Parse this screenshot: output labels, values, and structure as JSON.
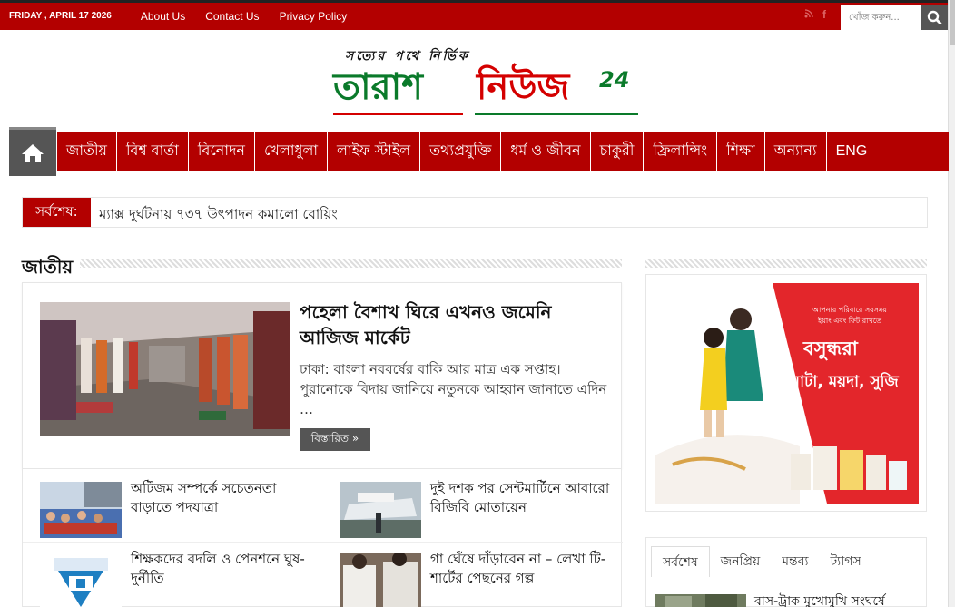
{
  "topbar": {
    "date": "FRIDAY , APRIL 17 2026",
    "links": [
      "About Us",
      "Contact Us",
      "Privacy Policy"
    ],
    "search_placeholder": "খোঁজ করুন..."
  },
  "logo": {
    "tagline": "সত্যের পথে নির্ভিক",
    "word1": "তারাশ",
    "word2": "নিউজ",
    "number": "24"
  },
  "nav": {
    "items": [
      "জাতীয়",
      "বিশ্ব বার্তা",
      "বিনোদন",
      "খেলাধুলা",
      "লাইফ স্টাইল",
      "তথ্যপ্রযুক্তি",
      "ধর্ম ও জীবন",
      "চাকুরী",
      "ফ্রিলান্সিং",
      "শিক্ষা",
      "অন্যান্য",
      "ENG"
    ]
  },
  "ticker": {
    "label": "সর্বশেষ:",
    "text": "ম্যাক্স দুর্ঘটনায় ৭৩৭ উৎপাদন কমালো বোয়িং"
  },
  "section": {
    "title": "জাতীয়"
  },
  "featured": {
    "title": "পহেলা বৈশাখ ঘিরে এখনও জমেনি আজিজ মার্কেট",
    "excerpt": "ঢাকা: বাংলা নববর্ষের বাকি আর মাত্র এক সপ্তাহ। পুরানোকে বিদায় জানিয়ে নতুনকে আহ্বান জানাতে এদিন …",
    "more": "বিস্তারিত »"
  },
  "list": [
    {
      "title": "অটিজম সম্পর্কে সচেতনতা বাড়াতে পদযাত্রা"
    },
    {
      "title": "দুই দশক পর সেন্টমার্টিনে আবারো বিজিবি মোতায়েন"
    },
    {
      "title": "শিক্ষকদের বদলি ও পেনশনে ঘুষ-দুর্নীতি"
    },
    {
      "title": "গা ঘেঁষে দাঁড়াবেন না – লেখা টি-শার্টের পেছনের গল্প"
    }
  ],
  "ad": {
    "line1": "আপনার পরিবারে সবসময়",
    "line2": "ইয়াং এবং ফিট রাখতে",
    "brand": "বসুন্ধরা",
    "products": "আটা, ময়দা, সুজি"
  },
  "sidebar_tabs": {
    "tabs": [
      "সর্বশেষ",
      "জনপ্রিয়",
      "মন্তব্য",
      "ট্যাগস"
    ],
    "first_item": "বাস-ট্রাক মুখোমুখি সংঘর্ষে"
  },
  "colors": {
    "brand_red": "#b30000",
    "logo_green": "#0a7a2a",
    "dark_gray": "#555555"
  }
}
